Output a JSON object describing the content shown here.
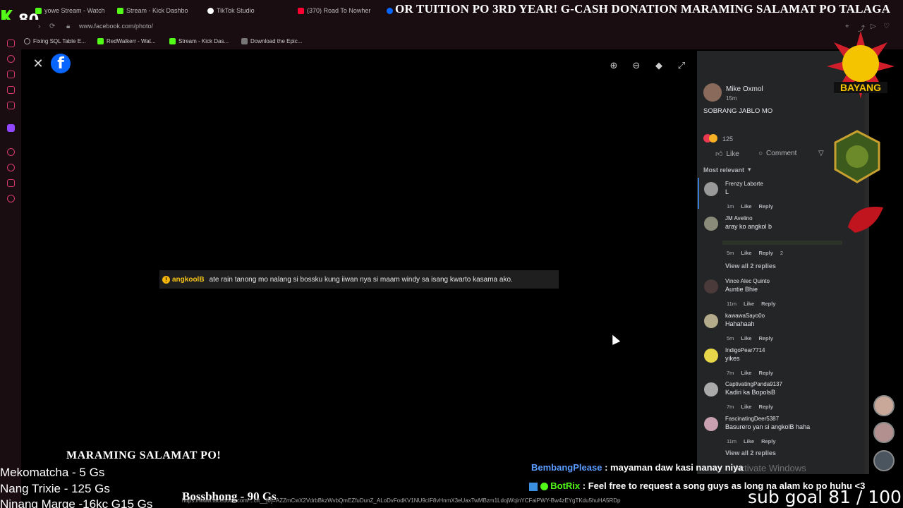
{
  "browser": {
    "viewer_count": "80",
    "tabs": [
      {
        "label": "yowe Stream - Watch",
        "color": "#53fc18"
      },
      {
        "label": "Stream - Kick Dashbo",
        "color": "#53fc18"
      },
      {
        "label": "TikTok Studio",
        "color": "#ffffff"
      },
      {
        "label": "(370) Road To Nowher",
        "color": "#ff0033"
      }
    ],
    "url": "www.facebook.com/photo/",
    "bookmarks": [
      {
        "label": "Fixing SQL Table E...",
        "color": "#aaaaaa"
      },
      {
        "label": "RedWalkerr - Wat...",
        "color": "#53fc18"
      },
      {
        "label": "Stream - Kick Das...",
        "color": "#53fc18"
      },
      {
        "label": "Download the Epic...",
        "color": "#cccccc"
      }
    ]
  },
  "ticker": "OR TUITION PO 3RD YEAR! G-CASH DONATION MARAMING SALAMAT PO TALAGA",
  "viewer": {
    "close_icon": "close-icon",
    "tools": [
      "zoom-in-icon",
      "zoom-out-icon",
      "tag-icon",
      "fullscreen-icon"
    ]
  },
  "chat_overlay": {
    "user": "angkoolB",
    "message": "ate rain tanong mo nalang si bossku kung iiwan nya si maam windy sa isang kwarto kasama ako."
  },
  "post": {
    "author": "Mike Oxmol",
    "time": "15m",
    "text": "SOBRANG JABLO MO",
    "reaction_count": "125",
    "like_label": "Like",
    "comment_label": "Comment",
    "sort_label": "Most relevant"
  },
  "comments": [
    {
      "name": "Frenzy Laborte",
      "text": "L",
      "time": "1m",
      "like": "Like",
      "reply": "Reply"
    },
    {
      "name": "JM Avelino",
      "text": "aray ko angkol b",
      "time": "5m",
      "like": "Like",
      "reply": "Reply",
      "reactions": "2"
    },
    {
      "name": "Vince Alec Quinto",
      "text": "Auntie Bhie",
      "time": "11m",
      "like": "Like",
      "reply": "Reply"
    },
    {
      "name": "kawawaSayo0o",
      "text": "Hahahaah",
      "time": "5m",
      "like": "Like",
      "reply": "Reply"
    },
    {
      "name": "IndigoPear7714",
      "text": "yikes",
      "time": "7m",
      "like": "Like",
      "reply": "Reply"
    },
    {
      "name": "CaptivatingPanda9137",
      "text": "Kadiri ka BopolsB",
      "time": "7m",
      "like": "Like",
      "reply": "Reply"
    },
    {
      "name": "FascinatingDeer5387",
      "text": "Basurero yan si angkolB haha",
      "time": "11m",
      "like": "Like",
      "reply": "Reply"
    }
  ],
  "view_replies": [
    "View all 2 replies",
    "View all 2 replies"
  ],
  "stream": {
    "thanks": "MARAMING SALAMAT PO!",
    "donors": [
      "Mekomatcha - 5 Gs",
      "Nang Trixie - 125 Gs",
      "Ninang Marge -16kc G15 Gs"
    ],
    "top_donor": "Bossbhong - 90 Gs",
    "chat": [
      {
        "user": "BembangPlease",
        "sep": ":",
        "text": "mayaman daw kasi nanay niya",
        "color": "#5a9cff"
      },
      {
        "user": "BotRix",
        "sep": ":",
        "text": "Feel free to request a song guys as long na alam ko po huhu <3",
        "color": "#53fc18"
      }
    ],
    "subgoal": "sub goal 81 / 100",
    "activate": "Activate Windows",
    "logo_text": "BAYANG"
  },
  "status_url": "https://www.facebook.com/...cft__[0]=AZZmCwX2VdrbBkzWvbQmEZfuDunZ_ALoDvFodKV1NU9cIF8vHnmX3eUaxTwMBzm1LdojWqinYCFaiPWY-Bw4zEYgTKdu5huHA5RDp"
}
